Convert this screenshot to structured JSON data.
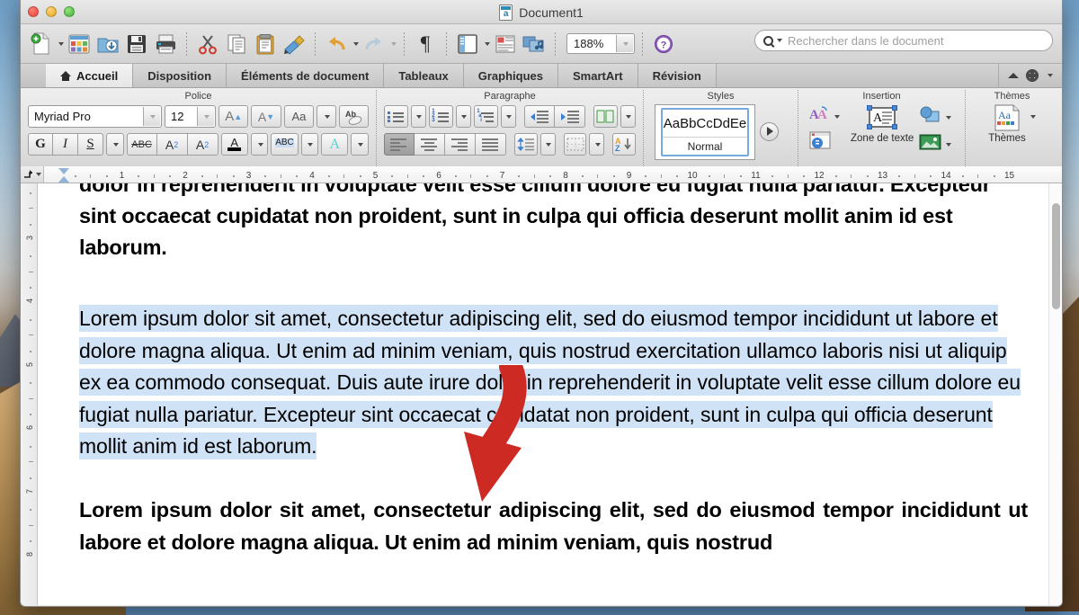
{
  "window": {
    "title": "Document1",
    "traffic_lights": [
      "close",
      "minimize",
      "maximize"
    ]
  },
  "search": {
    "placeholder": "Rechercher dans le document",
    "value": ""
  },
  "standard_toolbar": {
    "items": [
      {
        "name": "new-document-button",
        "icon": "new-doc-icon",
        "has_dropdown": true
      },
      {
        "name": "open-template-gallery-button",
        "icon": "template-gallery-icon"
      },
      {
        "name": "open-button",
        "icon": "open-folder-icon"
      },
      {
        "name": "save-button",
        "icon": "floppy-disk-icon"
      },
      {
        "name": "print-button",
        "icon": "printer-icon"
      },
      {
        "name": "cut-button",
        "icon": "scissors-icon"
      },
      {
        "name": "copy-button",
        "icon": "copy-icon"
      },
      {
        "name": "paste-button",
        "icon": "clipboard-icon"
      },
      {
        "name": "format-painter-button",
        "icon": "paintbrush-icon"
      },
      {
        "name": "undo-button",
        "icon": "undo-arrow-icon",
        "has_dropdown": true
      },
      {
        "name": "redo-button",
        "icon": "redo-arrow-icon",
        "has_dropdown": true,
        "disabled": true
      },
      {
        "name": "show-formatting-marks-button",
        "icon": "pilcrow-icon"
      },
      {
        "name": "sidebar-button",
        "icon": "sidebar-panel-icon",
        "has_dropdown": true
      },
      {
        "name": "publication-layout-button",
        "icon": "publication-layout-icon"
      },
      {
        "name": "media-browser-button",
        "icon": "media-browser-icon"
      },
      {
        "name": "help-button",
        "icon": "help-question-icon"
      }
    ],
    "zoom_value": "188%"
  },
  "ribbon_tabs": {
    "items": [
      {
        "label": "Accueil",
        "icon": "home-icon",
        "active": true
      },
      {
        "label": "Disposition",
        "active": false
      },
      {
        "label": "Éléments de document",
        "active": false
      },
      {
        "label": "Tableaux",
        "active": false
      },
      {
        "label": "Graphiques",
        "active": false
      },
      {
        "label": "SmartArt",
        "active": false
      },
      {
        "label": "Révision",
        "active": false
      }
    ],
    "collapse_icon": "chevron-up-icon",
    "settings_icon": "gear-icon"
  },
  "ribbon": {
    "groups": [
      {
        "name": "police",
        "label": "Police",
        "font_name": "Myriad Pro",
        "font_size": "12",
        "buttons_row1": [
          {
            "name": "grow-font-button",
            "label": "A",
            "icon": "increase-font-icon"
          },
          {
            "name": "shrink-font-button",
            "label": "A",
            "icon": "decrease-font-icon"
          },
          {
            "name": "change-case-button",
            "label": "Aa",
            "icon": "change-case-icon"
          },
          {
            "name": "clear-formatting-button",
            "label": "Ab",
            "icon": "clear-formatting-icon"
          }
        ],
        "buttons_row2": [
          {
            "name": "bold-button",
            "label": "G",
            "icon": "bold-icon"
          },
          {
            "name": "italic-button",
            "label": "I",
            "icon": "italic-icon"
          },
          {
            "name": "underline-button",
            "label": "S",
            "icon": "underline-icon"
          },
          {
            "name": "strikethrough-button",
            "label": "ABC",
            "icon": "strikethrough-icon"
          },
          {
            "name": "superscript-button",
            "label": "A2",
            "icon": "superscript-icon"
          },
          {
            "name": "subscript-button",
            "label": "A2",
            "icon": "subscript-icon"
          },
          {
            "name": "font-color-button",
            "label": "A",
            "icon": "font-color-icon"
          },
          {
            "name": "highlight-button",
            "label": "ABC",
            "icon": "text-highlight-icon"
          },
          {
            "name": "text-effects-button",
            "label": "A",
            "icon": "text-effects-icon"
          }
        ]
      },
      {
        "name": "paragraphe",
        "label": "Paragraphe",
        "buttons_row1": [
          {
            "name": "bulleted-list-button",
            "icon": "bulleted-list-icon"
          },
          {
            "name": "numbered-list-button",
            "icon": "numbered-list-icon"
          },
          {
            "name": "multilevel-list-button",
            "icon": "multilevel-list-icon"
          },
          {
            "name": "decrease-indent-button",
            "icon": "decrease-indent-icon"
          },
          {
            "name": "increase-indent-button",
            "icon": "increase-indent-icon"
          },
          {
            "name": "columns-button",
            "icon": "columns-icon"
          }
        ],
        "buttons_row2": [
          {
            "name": "align-left-button",
            "icon": "align-left-icon",
            "active": true
          },
          {
            "name": "align-center-button",
            "icon": "align-center-icon"
          },
          {
            "name": "align-right-button",
            "icon": "align-right-icon"
          },
          {
            "name": "justify-button",
            "icon": "justify-icon"
          },
          {
            "name": "line-spacing-button",
            "icon": "line-spacing-icon"
          },
          {
            "name": "borders-button",
            "icon": "borders-icon"
          },
          {
            "name": "sort-button",
            "icon": "sort-az-icon"
          }
        ]
      },
      {
        "name": "styles",
        "label": "Styles",
        "gallery_preview": "AaBbCcDdEe",
        "gallery_name": "Normal",
        "more_button": "styles-more-button"
      },
      {
        "name": "insertion",
        "label": "Insertion",
        "text_box_label": "Zone de texte",
        "buttons": [
          {
            "name": "wordart-button",
            "icon": "wordart-icon"
          },
          {
            "name": "comment-button",
            "icon": "comment-icon"
          },
          {
            "name": "text-box-button",
            "icon": "text-box-icon"
          },
          {
            "name": "shapes-button",
            "icon": "shapes-icon"
          },
          {
            "name": "picture-button",
            "icon": "picture-icon"
          }
        ]
      },
      {
        "name": "themes",
        "label": "Thèmes",
        "themes_label": "Thèmes",
        "preview": "Aa"
      }
    ]
  },
  "ruler": {
    "horizontal_numbers": [
      "1",
      "2",
      "3",
      "4",
      "5",
      "6",
      "7",
      "8",
      "9",
      "10",
      "11",
      "12",
      "13",
      "14",
      "15"
    ],
    "vertical_numbers": [
      "3",
      "4",
      "5",
      "6",
      "7",
      "8"
    ],
    "tab_selector_icon": "tab-stop-selector-icon"
  },
  "document": {
    "paragraph_clipped": "dolor in reprehenderit in voluptate velit esse cillum dolore eu fugiat nulla pariatur. Excepteur sint occaecat cupidatat non proident, sunt in culpa qui officia deserunt mollit anim id est laborum.",
    "paragraph_selected": "Lorem ipsum dolor sit amet, consectetur adipiscing elit, sed do eiusmod tempor incididunt ut labore et dolore magna aliqua. Ut enim ad minim veniam, quis nostrud exercitation ullamco laboris nisi ut aliquip ex ea commodo consequat. Duis aute irure dolor in reprehenderit in voluptate velit esse cillum dolore eu fugiat nulla pariatur. Excepteur sint occaecat cupidatat non proident, sunt in culpa qui officia deserunt mollit anim id est laborum.",
    "paragraph_bottom": "Lorem ipsum dolor sit amet, consectetur adipiscing elit, sed do eiusmod tempor incididunt ut labore et dolore magna aliqua. Ut enim ad minim veniam, quis nostrud",
    "selection_color": "#cfe2f6",
    "annotation_arrow_color": "#cc2a22",
    "annotation_icon": "red-curved-arrow-annotation"
  }
}
